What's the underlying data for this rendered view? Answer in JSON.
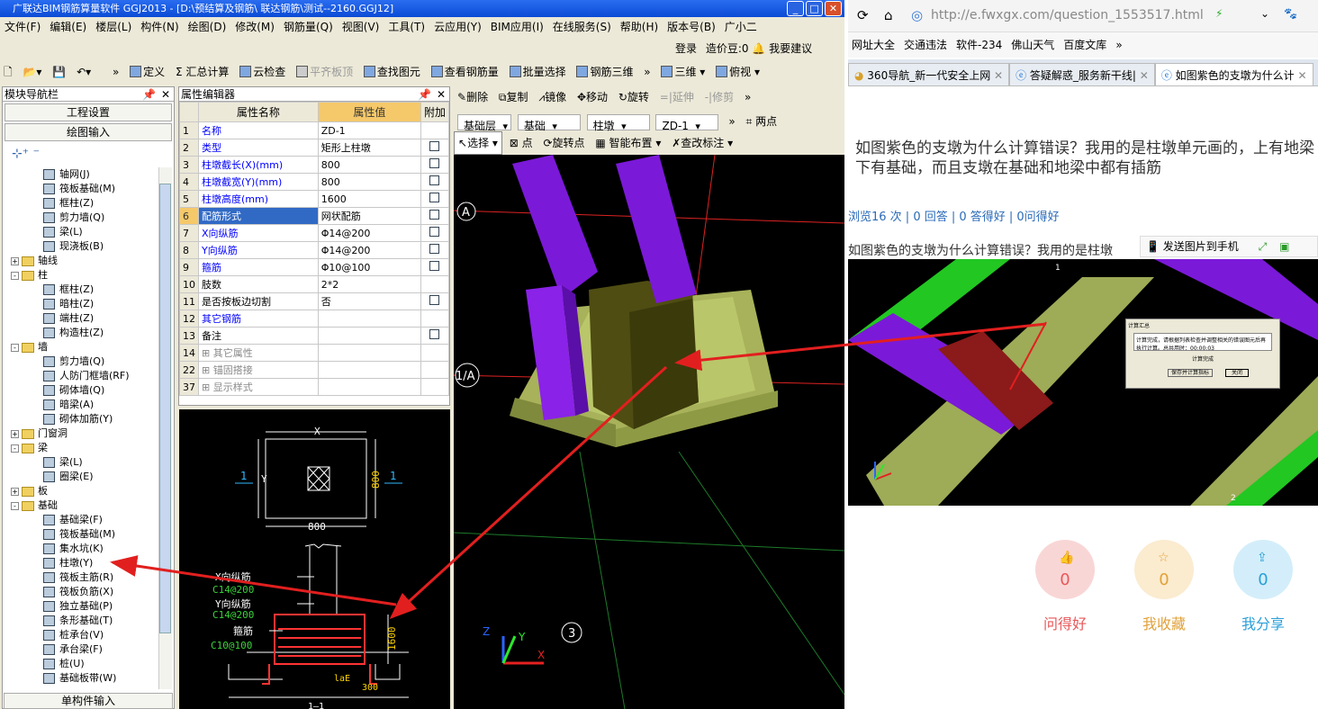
{
  "app": {
    "title": "广联达BIM钢筋算量软件 GGJ2013 - [D:\\预结算及钢筋\\ 联达钢筋\\测试--2160.GGJ12]",
    "menu": [
      "文件(F)",
      "编辑(E)",
      "楼层(L)",
      "构件(N)",
      "绘图(D)",
      "修改(M)",
      "钢筋量(Q)",
      "视图(V)",
      "工具(T)",
      "云应用(Y)",
      "BIM应用(I)",
      "在线服务(S)",
      "帮助(H)",
      "版本号(B)",
      "广小二"
    ],
    "login": {
      "login": "登录",
      "price": "造价豆:0",
      "suggest": "我要建议"
    },
    "toolbar": [
      "定义",
      "Σ 汇总计算",
      "云检查",
      "平齐板顶",
      "查找图元",
      "查看钢筋量",
      "批量选择",
      "钢筋三维",
      "三维",
      "俯视"
    ]
  },
  "nav": {
    "title": "模块导航栏",
    "btn_project": "工程设置",
    "btn_draw": "绘图输入",
    "btn_single": "单构件输入",
    "tree": [
      {
        "label": "轴网(J)",
        "level": 2,
        "type": "item"
      },
      {
        "label": "筏板基础(M)",
        "level": 2,
        "type": "item"
      },
      {
        "label": "框柱(Z)",
        "level": 2,
        "type": "item"
      },
      {
        "label": "剪力墙(Q)",
        "level": 2,
        "type": "item"
      },
      {
        "label": "梁(L)",
        "level": 2,
        "type": "item"
      },
      {
        "label": "现浇板(B)",
        "level": 2,
        "type": "item"
      },
      {
        "label": "轴线",
        "level": 1,
        "type": "folder",
        "exp": "+"
      },
      {
        "label": "柱",
        "level": 1,
        "type": "folder",
        "exp": "-"
      },
      {
        "label": "框柱(Z)",
        "level": 2,
        "type": "item"
      },
      {
        "label": "暗柱(Z)",
        "level": 2,
        "type": "item"
      },
      {
        "label": "端柱(Z)",
        "level": 2,
        "type": "item"
      },
      {
        "label": "构造柱(Z)",
        "level": 2,
        "type": "item"
      },
      {
        "label": "墙",
        "level": 1,
        "type": "folder",
        "exp": "-"
      },
      {
        "label": "剪力墙(Q)",
        "level": 2,
        "type": "item"
      },
      {
        "label": "人防门框墙(RF)",
        "level": 2,
        "type": "item"
      },
      {
        "label": "砌体墙(Q)",
        "level": 2,
        "type": "item"
      },
      {
        "label": "暗梁(A)",
        "level": 2,
        "type": "item"
      },
      {
        "label": "砌体加筋(Y)",
        "level": 2,
        "type": "item"
      },
      {
        "label": "门窗洞",
        "level": 1,
        "type": "folder",
        "exp": "+"
      },
      {
        "label": "梁",
        "level": 1,
        "type": "folder",
        "exp": "-"
      },
      {
        "label": "梁(L)",
        "level": 2,
        "type": "item"
      },
      {
        "label": "圈梁(E)",
        "level": 2,
        "type": "item"
      },
      {
        "label": "板",
        "level": 1,
        "type": "folder",
        "exp": "+"
      },
      {
        "label": "基础",
        "level": 1,
        "type": "folder",
        "exp": "-"
      },
      {
        "label": "基础梁(F)",
        "level": 2,
        "type": "item"
      },
      {
        "label": "筏板基础(M)",
        "level": 2,
        "type": "item"
      },
      {
        "label": "集水坑(K)",
        "level": 2,
        "type": "item"
      },
      {
        "label": "柱墩(Y)",
        "level": 2,
        "type": "item"
      },
      {
        "label": "筏板主筋(R)",
        "level": 2,
        "type": "item"
      },
      {
        "label": "筏板负筋(X)",
        "level": 2,
        "type": "item"
      },
      {
        "label": "独立基础(P)",
        "level": 2,
        "type": "item"
      },
      {
        "label": "条形基础(T)",
        "level": 2,
        "type": "item"
      },
      {
        "label": "桩承台(V)",
        "level": 2,
        "type": "item"
      },
      {
        "label": "承台梁(F)",
        "level": 2,
        "type": "item"
      },
      {
        "label": "桩(U)",
        "level": 2,
        "type": "item"
      },
      {
        "label": "基础板带(W)",
        "level": 2,
        "type": "item"
      }
    ]
  },
  "prop": {
    "title": "属性编辑器",
    "col_name": "属性名称",
    "col_value": "属性值",
    "col_add": "附加",
    "rows": [
      {
        "n": "1",
        "name": "名称",
        "value": "ZD-1",
        "chk": false
      },
      {
        "n": "2",
        "name": "类型",
        "value": "矩形上柱墩",
        "chk": true
      },
      {
        "n": "3",
        "name": "柱墩截长(X)(mm)",
        "value": "800",
        "chk": true
      },
      {
        "n": "4",
        "name": "柱墩截宽(Y)(mm)",
        "value": "800",
        "chk": true
      },
      {
        "n": "5",
        "name": "柱墩高度(mm)",
        "value": "1600",
        "chk": true
      },
      {
        "n": "6",
        "name": "配筋形式",
        "value": "网状配筋",
        "chk": true
      },
      {
        "n": "7",
        "name": "X向纵筋",
        "value": "Φ14@200",
        "chk": true
      },
      {
        "n": "8",
        "name": "Y向纵筋",
        "value": "Φ14@200",
        "chk": true
      },
      {
        "n": "9",
        "name": "箍筋",
        "value": "Φ10@100",
        "chk": true
      },
      {
        "n": "10",
        "name": "肢数",
        "value": "2*2",
        "chk": false
      },
      {
        "n": "11",
        "name": "是否按板边切割",
        "value": "否",
        "chk": true
      },
      {
        "n": "12",
        "name": "其它钢筋",
        "value": "",
        "chk": false
      },
      {
        "n": "13",
        "name": "备注",
        "value": "",
        "chk": true
      },
      {
        "n": "14",
        "name": "其它属性",
        "value": "",
        "chk": false
      },
      {
        "n": "22",
        "name": "锚固搭接",
        "value": "",
        "chk": false
      },
      {
        "n": "37",
        "name": "显示样式",
        "value": "",
        "chk": false
      }
    ]
  },
  "drawing": {
    "x": "X",
    "y": "Y",
    "w": "800",
    "h": "800",
    "sec": "1",
    "xbar": "X向纵筋",
    "xbar_v": "C14@200",
    "ybar": "Y向纵筋",
    "ybar_v": "C14@200",
    "stir": "箍筋",
    "stir_v": "C10@100",
    "height": "1600",
    "lae": "laE",
    "bottom": "300",
    "cut": "1—1"
  },
  "view3d": {
    "tools1": [
      "删除",
      "复制",
      "镜像",
      "移动",
      "旋转",
      "延伸",
      "修剪"
    ],
    "layer": "基础层",
    "cat": "基础",
    "type": "柱墩",
    "name": "ZD-1",
    "two_pts": "两点",
    "tools3": [
      "选择",
      "点",
      "旋转点",
      "智能布置",
      "查改标注"
    ],
    "axisA": "A",
    "axis1A": "1/A",
    "axis3": "3",
    "ax_z": "Z",
    "ax_y": "Y",
    "ax_x": "X"
  },
  "browser": {
    "url": "http://e.fwxgx.com/question_1553517.html",
    "bookmarks": [
      "网址大全",
      "交通违法",
      "软件-234",
      "佛山天气",
      "百度文库"
    ],
    "tabs": [
      "360导航_新一代安全上网",
      "答疑解惑_服务新干线|",
      "如图紫色的支墩为什么计"
    ],
    "question": "如图紫色的支墩为什么计算错误？我用的是柱墩单元画的，上有地梁下有基础，而且支墩在基础和地梁中都有插筋",
    "stats": "浏览16 次 | 0 回答 | 0 答得好 | 0问得好",
    "question_short": "如图紫色的支墩为什么计算错误？我用的是柱墩",
    "send": "发送图片到手机",
    "dialog_title": "计算汇总",
    "dialog_text": "计算完成，请根据列表检查并调整相关的错误图元后再执行计算。总共用时：00:00:03",
    "dialog_done": "计算完成",
    "dialog_save": "保存并计算指标",
    "dialog_close": "关闭",
    "actions": [
      {
        "label": "问得好",
        "count": "0",
        "color": "#e8575a",
        "bg": "#f9d6d6"
      },
      {
        "label": "我收藏",
        "count": "0",
        "color": "#e0a13a",
        "bg": "#fbebcf"
      },
      {
        "label": "我分享",
        "count": "0",
        "color": "#2a9fd8",
        "bg": "#d3eefa"
      }
    ]
  }
}
